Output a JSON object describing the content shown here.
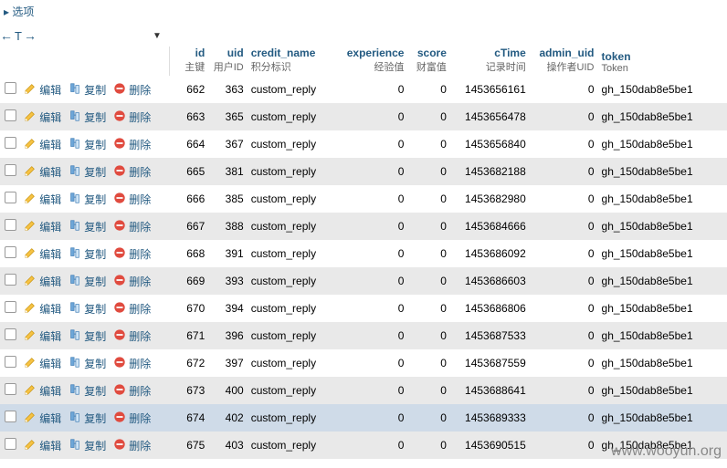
{
  "topbar": {
    "options_label": "选项"
  },
  "toolbar": {
    "arrow_left": "←",
    "t_glyph": "T",
    "arrow_right": "→",
    "drop_glyph": "▼"
  },
  "actions": {
    "edit": "编辑",
    "copy": "复制",
    "delete": "删除"
  },
  "columns": {
    "id": {
      "title": "id",
      "sub": "主键"
    },
    "uid": {
      "title": "uid",
      "sub": "用户ID"
    },
    "credit": {
      "title": "credit_name",
      "sub": "积分标识"
    },
    "exp": {
      "title": "experience",
      "sub": "经验值"
    },
    "score": {
      "title": "score",
      "sub": "财富值"
    },
    "ctime": {
      "title": "cTime",
      "sub": "记录时间"
    },
    "admin": {
      "title": "admin_uid",
      "sub": "操作者UID"
    },
    "token": {
      "title": "token",
      "sub": "Token"
    }
  },
  "rows": [
    {
      "id": 662,
      "uid": 363,
      "credit": "custom_reply",
      "exp": 0,
      "score": 0,
      "ctime": 1453656161,
      "admin": 0,
      "token": "gh_150dab8e5be1"
    },
    {
      "id": 663,
      "uid": 365,
      "credit": "custom_reply",
      "exp": 0,
      "score": 0,
      "ctime": 1453656478,
      "admin": 0,
      "token": "gh_150dab8e5be1"
    },
    {
      "id": 664,
      "uid": 367,
      "credit": "custom_reply",
      "exp": 0,
      "score": 0,
      "ctime": 1453656840,
      "admin": 0,
      "token": "gh_150dab8e5be1"
    },
    {
      "id": 665,
      "uid": 381,
      "credit": "custom_reply",
      "exp": 0,
      "score": 0,
      "ctime": 1453682188,
      "admin": 0,
      "token": "gh_150dab8e5be1"
    },
    {
      "id": 666,
      "uid": 385,
      "credit": "custom_reply",
      "exp": 0,
      "score": 0,
      "ctime": 1453682980,
      "admin": 0,
      "token": "gh_150dab8e5be1"
    },
    {
      "id": 667,
      "uid": 388,
      "credit": "custom_reply",
      "exp": 0,
      "score": 0,
      "ctime": 1453684666,
      "admin": 0,
      "token": "gh_150dab8e5be1"
    },
    {
      "id": 668,
      "uid": 391,
      "credit": "custom_reply",
      "exp": 0,
      "score": 0,
      "ctime": 1453686092,
      "admin": 0,
      "token": "gh_150dab8e5be1"
    },
    {
      "id": 669,
      "uid": 393,
      "credit": "custom_reply",
      "exp": 0,
      "score": 0,
      "ctime": 1453686603,
      "admin": 0,
      "token": "gh_150dab8e5be1"
    },
    {
      "id": 670,
      "uid": 394,
      "credit": "custom_reply",
      "exp": 0,
      "score": 0,
      "ctime": 1453686806,
      "admin": 0,
      "token": "gh_150dab8e5be1"
    },
    {
      "id": 671,
      "uid": 396,
      "credit": "custom_reply",
      "exp": 0,
      "score": 0,
      "ctime": 1453687533,
      "admin": 0,
      "token": "gh_150dab8e5be1"
    },
    {
      "id": 672,
      "uid": 397,
      "credit": "custom_reply",
      "exp": 0,
      "score": 0,
      "ctime": 1453687559,
      "admin": 0,
      "token": "gh_150dab8e5be1"
    },
    {
      "id": 673,
      "uid": 400,
      "credit": "custom_reply",
      "exp": 0,
      "score": 0,
      "ctime": 1453688641,
      "admin": 0,
      "token": "gh_150dab8e5be1"
    },
    {
      "id": 674,
      "uid": 402,
      "credit": "custom_reply",
      "exp": 0,
      "score": 0,
      "ctime": 1453689333,
      "admin": 0,
      "token": "gh_150dab8e5be1",
      "highlight": true
    },
    {
      "id": 675,
      "uid": 403,
      "credit": "custom_reply",
      "exp": 0,
      "score": 0,
      "ctime": 1453690515,
      "admin": 0,
      "token": "gh_150dab8e5be1"
    }
  ],
  "watermark": "www.wooyun.org"
}
